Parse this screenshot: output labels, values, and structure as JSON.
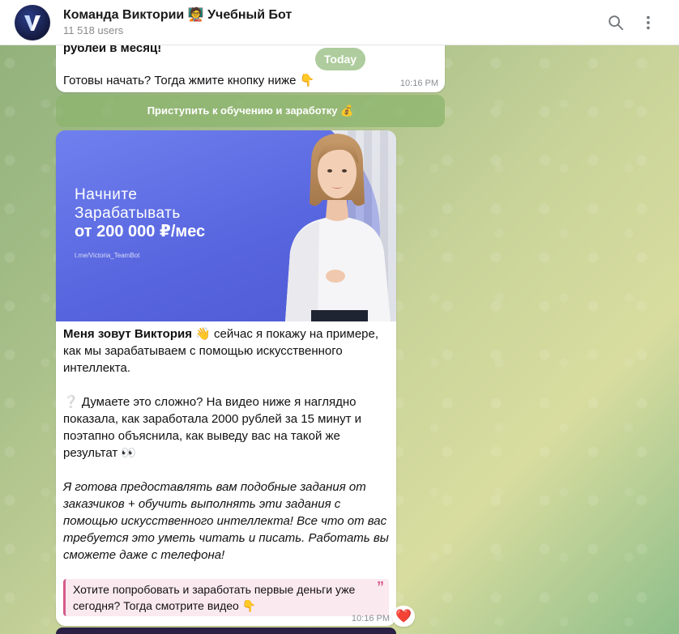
{
  "header": {
    "title": "Команда Виктории 🧑‍🏫 Учебный Бот",
    "subtitle": "11 518 users"
  },
  "messages": {
    "top": {
      "line1": "рублей в месяц!",
      "line2": "Готовы начать? Тогда жмите кнопку ниже 👇",
      "time": "10:16 PM"
    },
    "today_label": "Today",
    "inline_button": "Приступить к обучению и заработку 💰",
    "main": {
      "banner": {
        "line1": "Начните",
        "line2": "Зарабатывать",
        "line3": "от 200 000 ₽/мес",
        "url": "t.me/Victoria_TeamBot"
      },
      "p1_bold": "Меня зовут Виктория",
      "p1_rest": " 👋 сейчас я покажу на примере, как мы зарабатываем с помощью искусственного интеллекта.",
      "p2": "❔ Думаете это сложно? На видео ниже я наглядно показала, как заработала 2000 рублей за 15 минут и поэтапно объяснила, как выведу вас на такой же результат 👀",
      "p3": "Я готова предоставлять вам подобные задания от заказчиков + обучить выполнять эти задания с помощью искусственного интеллекта! Все что от вас требуется это уметь читать и писать. Работать вы сможете даже с телефона!",
      "quote": "Хотите попробовать и заработать первые деньги уже сегодня? Тогда смотрите видео 👇",
      "time": "10:16 PM",
      "reaction": "❤️"
    }
  },
  "colors": {
    "accent_quote": "#d65b8a",
    "banner_blue": "#5664de"
  }
}
